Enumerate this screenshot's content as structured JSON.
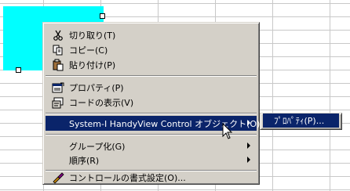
{
  "context_menu": {
    "items": [
      {
        "label": "切り取り(T)",
        "icon": "scissors-icon"
      },
      {
        "label": "コピー(C)",
        "icon": "copy-icon"
      },
      {
        "label": "貼り付け(P)",
        "icon": "paste-icon"
      },
      {
        "label": "プロパティ(P)",
        "icon": "properties-icon"
      },
      {
        "label": "コードの表示(V)",
        "icon": "view-code-icon"
      },
      {
        "label": "System-I HandyView Control オブジェクト(O)",
        "has_submenu": true,
        "highlighted": true
      },
      {
        "label": "グループ化(G)",
        "has_submenu": true
      },
      {
        "label": "順序(R)",
        "has_submenu": true
      },
      {
        "label": "コントロールの書式設定(O)...",
        "icon": "format-control-icon"
      }
    ]
  },
  "submenu": {
    "items": [
      {
        "label": "ﾌﾟﾛﾊﾟﾃｨ(P)...",
        "highlighted": true
      }
    ]
  },
  "colors": {
    "selected_control": "#00ffff",
    "menu_bg": "#d4d0c8",
    "highlight": "#0a246a"
  }
}
